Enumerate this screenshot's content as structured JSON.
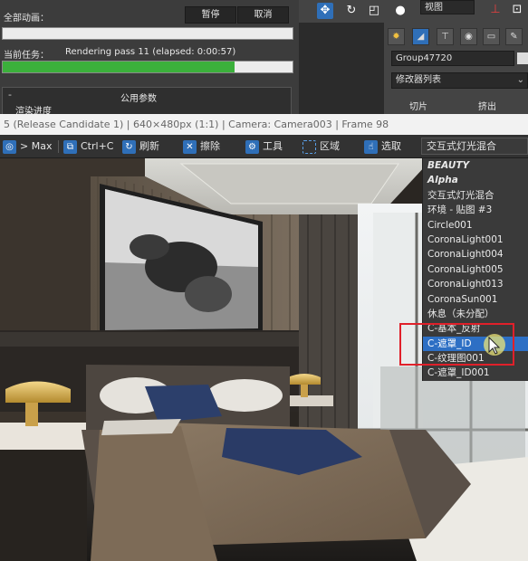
{
  "progress_panel": {
    "total_animation_label": "全部动画：",
    "pause_label": "暂停",
    "cancel_label": "取消",
    "current_task_label": "当前任务：",
    "current_task_value": "Rendering pass 11 (elapsed: 0:00:57)",
    "task_progress": 0.8,
    "rollout_title": "公用参数",
    "rollout_sub": "渲染进度"
  },
  "command_panel": {
    "view_dropdown": "视图",
    "object_name": "Group47720",
    "modifier_list": "修改器列表",
    "tab_left": "切片",
    "tab_right": "挤出"
  },
  "frame_buffer": {
    "title": "5 (Release Candidate 1) | 640×480px (1:1) | Camera: Camera003 | Frame 98",
    "toolbar": {
      "max_label": "> Max",
      "copy_label": "Ctrl+C",
      "refresh_label": "刷新",
      "erase_label": "擦除",
      "tools_label": "工具",
      "region_label": "区域",
      "select_label": "选取",
      "channel_selected": "交互式灯光混合"
    },
    "channels": [
      "BEAUTY",
      "Alpha",
      "交互式灯光混合",
      "环境 - 贴图 #3",
      "Circle001",
      "CoronaLight001",
      "CoronaLight004",
      "CoronaLight005",
      "CoronaLight013",
      "CoronaSun001",
      "休息（未分配）",
      "C-基本_反射",
      "C-遮罩_ID",
      "C-纹理图001",
      "C-遮罩_ID001"
    ],
    "selected_channel_index": 12
  },
  "colors": {
    "progress_green": "#3bb03b",
    "selection_blue": "#2d6fc4",
    "highlight_red": "#e0202a"
  }
}
